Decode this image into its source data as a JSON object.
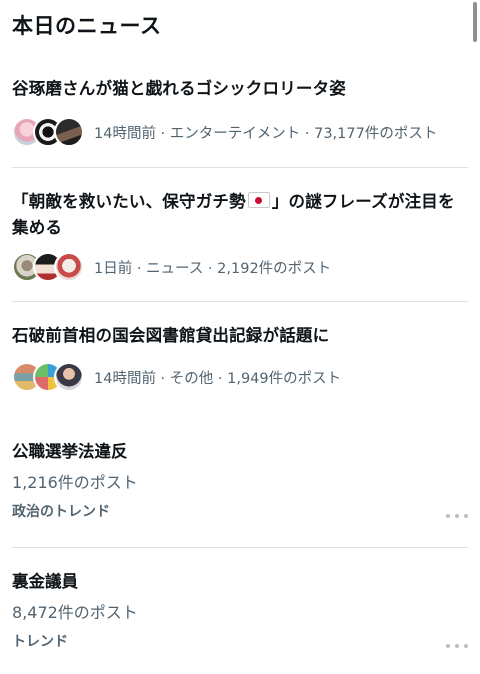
{
  "section": {
    "title": "本日のニュース"
  },
  "news": [
    {
      "headline": "谷琢磨さんが猫と戯れるゴシックロリータ姿",
      "meta": "14時間前 · エンターテイメント · 73,177件のポスト",
      "avatars": [
        "avatar-pink-hair",
        "avatar-black-cat",
        "avatar-dark-character"
      ]
    },
    {
      "headline_before_flag": "「朝敵を救いたい、保守ガチ勢",
      "headline_after_flag": "」の謎フレーズが注目を集める",
      "flag_icon": "japan-flag-icon",
      "meta": "1日前 · ニュース · 2,192件のポスト",
      "avatars": [
        "avatar-dog-glasses",
        "avatar-anime-girl",
        "avatar-illustration"
      ]
    },
    {
      "headline": "石破前首相の国会図書館貸出記録が話題に",
      "meta": "14時間前 · その他 · 1,949件のポスト",
      "avatars": [
        "avatar-landscape",
        "avatar-colorful",
        "avatar-man-suit"
      ]
    }
  ],
  "trends": [
    {
      "title": "公職選挙法違反",
      "count": "1,216件のポスト",
      "category": "政治のトレンド"
    },
    {
      "title": "裏金議員",
      "count": "8,472件のポスト",
      "category": "トレンド"
    }
  ],
  "colors": {
    "text_primary": "#0f1419",
    "text_secondary": "#536471",
    "divider": "#dfe2e5"
  }
}
